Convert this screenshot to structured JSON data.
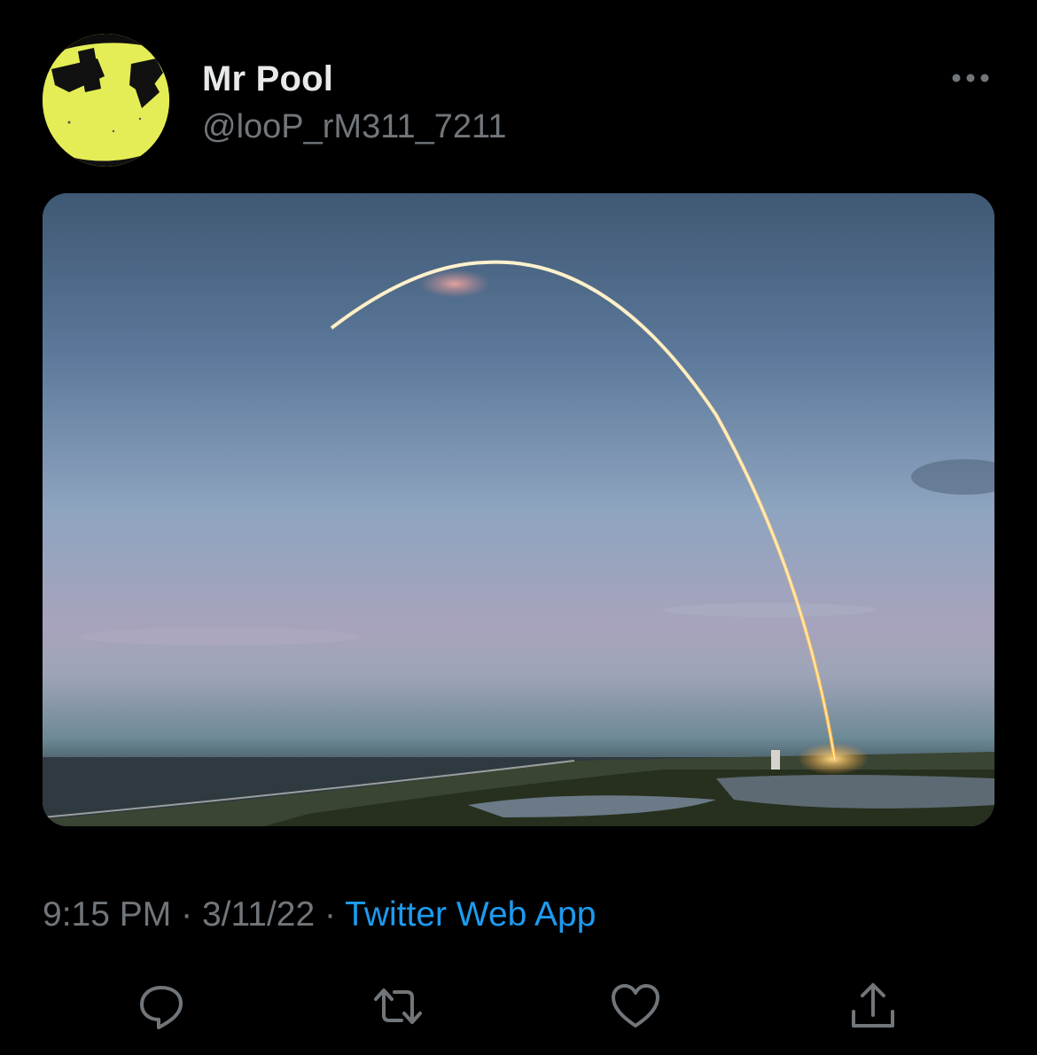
{
  "tweet": {
    "display_name": "Mr Pool",
    "handle": "@looP_rM311_7211",
    "time": "9:15 PM",
    "separator": "·",
    "date": "3/11/22",
    "source": "Twitter Web App"
  },
  "icons": {
    "avatar": "avatar-image",
    "more": "more-options-icon",
    "reply": "reply-icon",
    "retweet": "retweet-icon",
    "like": "heart-icon",
    "share": "share-icon"
  },
  "colors": {
    "background": "#000000",
    "primary_text": "#e7e9ea",
    "secondary_text": "#71767b",
    "link": "#1d9bf0",
    "avatar_yellow": "#e6ef5b"
  }
}
